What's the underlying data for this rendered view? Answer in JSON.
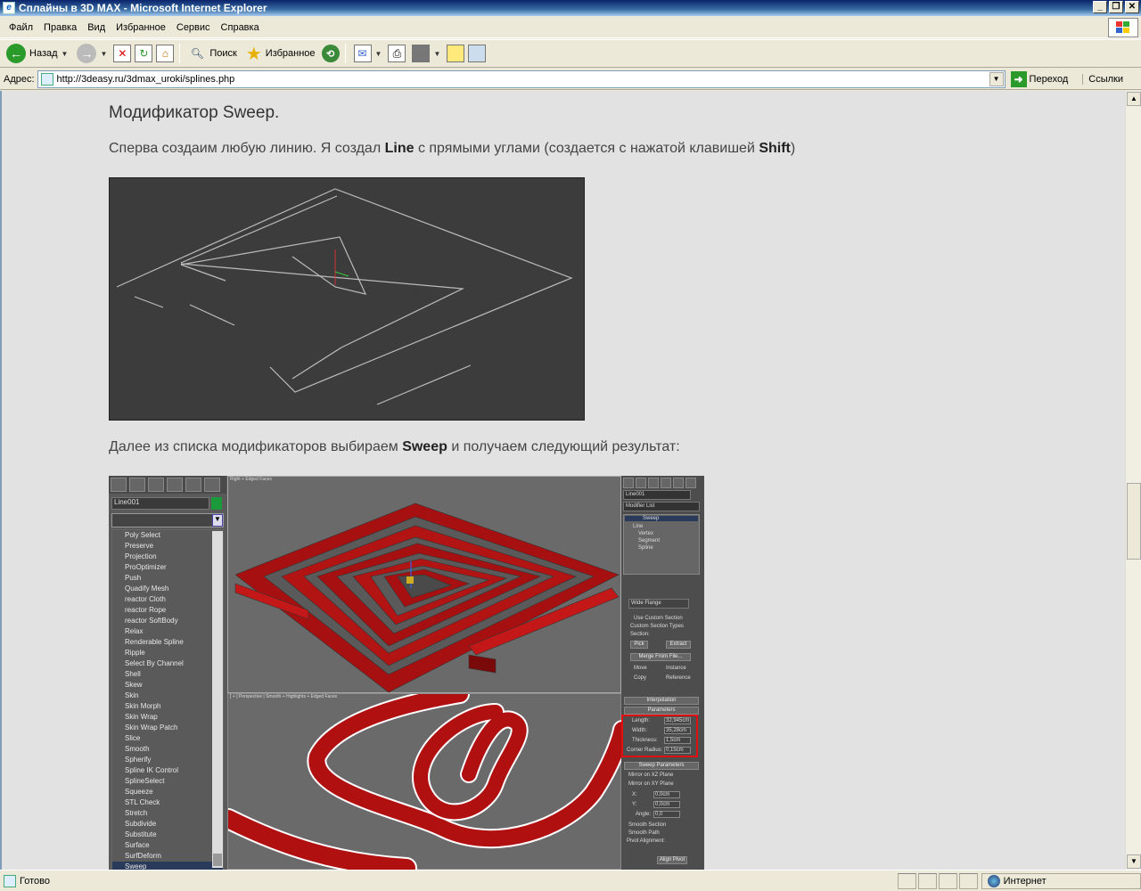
{
  "window": {
    "title": "Сплайны в 3D MAX - Microsoft Internet Explorer",
    "buttons": [
      "_",
      "❐",
      "✕"
    ]
  },
  "menu": [
    "Файл",
    "Правка",
    "Вид",
    "Избранное",
    "Сервис",
    "Справка"
  ],
  "toolbar": {
    "back_label": "Назад",
    "search_label": "Поиск",
    "favorites_label": "Избранное"
  },
  "address": {
    "label": "Адрес:",
    "url": "http://3deasy.ru/3dmax_uroki/splines.php",
    "go_label": "Переход",
    "links_label": "Ссылки"
  },
  "article": {
    "heading": "Модификатор Sweep.",
    "p1_pre": "Сперва создаим любую линию. Я создал ",
    "p1_b1": "Line",
    "p1_mid": " с прямыми углами (создается с нажатой клавишей ",
    "p1_b2": "Shift",
    "p1_post": ")",
    "p2_pre": "Далее из списка модификаторов выбираем ",
    "p2_b": "Sweep",
    "p2_post": " и получаем следующий результат:"
  },
  "max_ui": {
    "object_name": "Line001",
    "modifier_list": [
      "Poly Select",
      "Preserve",
      "Projection",
      "ProOptimizer",
      "Push",
      "Quadify Mesh",
      "reactor Cloth",
      "reactor Rope",
      "reactor SoftBody",
      "Relax",
      "Renderable Spline",
      "Ripple",
      "Select By Channel",
      "Shell",
      "Skew",
      "Skin",
      "Skin Morph",
      "Skin Wrap",
      "Skin Wrap Patch",
      "Slice",
      "Smooth",
      "Spherify",
      "Spline IK Control",
      "SplineSelect",
      "Squeeze",
      "STL Check",
      "Stretch",
      "Subdivide",
      "Substitute",
      "Surface",
      "SurfDeform",
      "Sweep"
    ],
    "selected_modifier": "Sweep",
    "panel": {
      "name_field": "Line001",
      "modlist_label": "Modifier List",
      "stack_sweep": "Sweep",
      "stack_line": "Line",
      "stack_vertex": "Vertex",
      "stack_segment": "Segment",
      "stack_spline": "Spline",
      "section_type": "Wide Flange",
      "use_custom": "Use Custom Section",
      "custom_types": "Custom Section Types",
      "section": "Section:",
      "pick": "Pick",
      "extract": "Extract",
      "merge": "Merge From File...",
      "move": "Move",
      "instance": "Instance",
      "copy": "Copy",
      "reference": "Reference",
      "interpolation": "Interpolation",
      "parameters": "Parameters",
      "length_label": "Length:",
      "length": "32,945cm",
      "width_label": "Width:",
      "width": "35,28cm",
      "thickness_label": "Thickness:",
      "thickness": "1,5cm",
      "corner_label": "Corner Radius:",
      "corner": "0,15cm",
      "sweep_params": "Sweep Parameters",
      "mirror_xz": "Mirror on XZ Plane",
      "mirror_xy": "Mirror on XY Plane",
      "x_label": "X:",
      "x_val": "0,0cm",
      "y_label": "Y:",
      "y_val": "0,0cm",
      "angle_label": "Angle:",
      "angle_val": "0,0",
      "smooth_section": "Smooth Section",
      "smooth_path": "Smooth Path",
      "pivot_alignment": "Pivot Alignment:",
      "align_pivot": "Align Pivot"
    },
    "vp1_label": "Right + Edged Faces",
    "vp2_label": "[ + ] Perspective | Smooth + Highlights + Edged Faces"
  },
  "status": {
    "text": "Готово",
    "zone": "Интернет"
  },
  "colors": {
    "sweep_red": "#b01010",
    "highlight_red": "#e01010"
  }
}
